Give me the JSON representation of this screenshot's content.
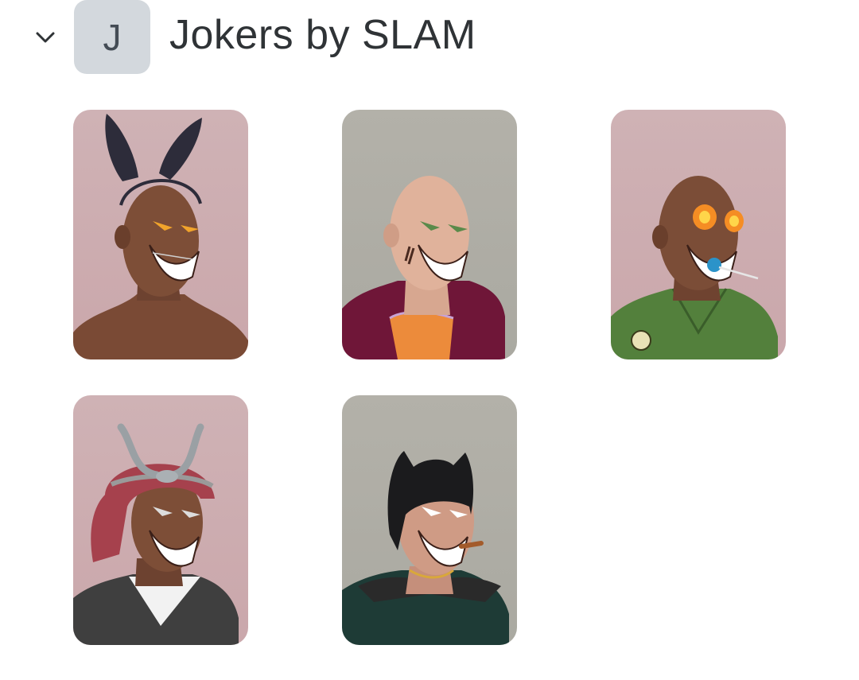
{
  "collection": {
    "avatar_letter": "J",
    "title": "Jokers by SLAM",
    "expand_icon": "chevron-down-icon"
  },
  "nfts": [
    {
      "variant": "bunny-ears",
      "background": "#cdb0b3"
    },
    {
      "variant": "purple-hoodie",
      "background": "#aeada6"
    },
    {
      "variant": "fire-eyes-lollipop",
      "background": "#cdb0b3"
    },
    {
      "variant": "samurai-helmet",
      "background": "#cdb0b3"
    },
    {
      "variant": "cat-mask",
      "background": "#aeada6"
    }
  ]
}
